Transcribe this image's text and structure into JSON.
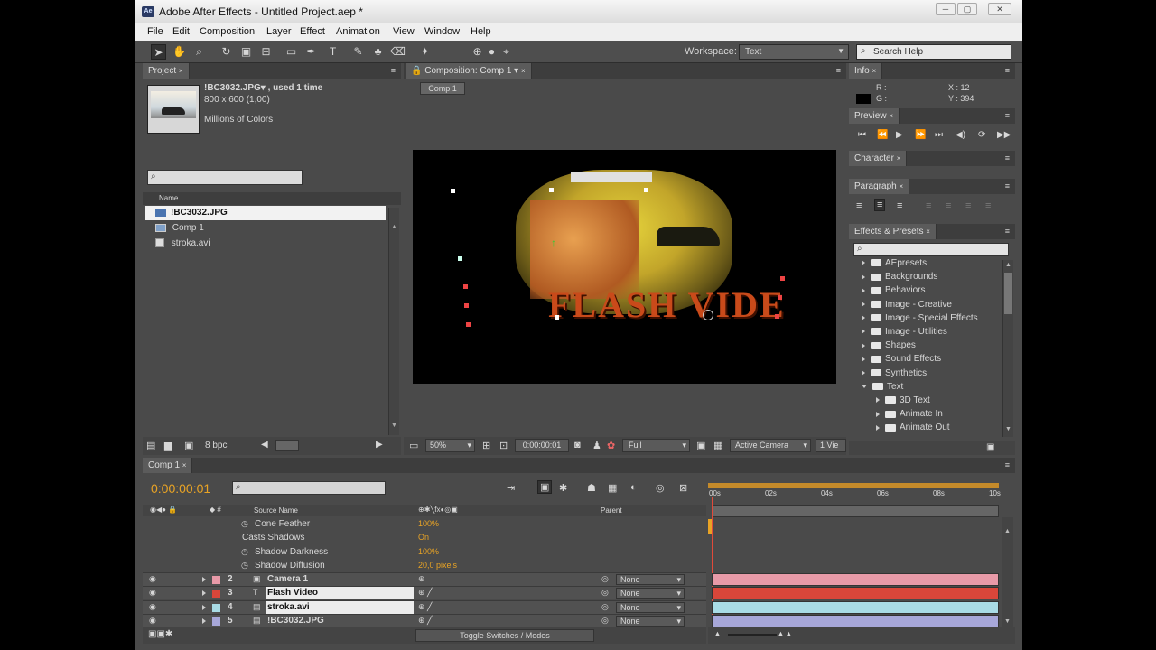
{
  "window": {
    "title": "Adobe After Effects - Untitled Project.aep *",
    "app_badge": "Ae",
    "min": "─",
    "max": "▢",
    "close": "✕"
  },
  "menu": [
    "File",
    "Edit",
    "Composition",
    "Layer",
    "Effect",
    "Animation",
    "View",
    "Window",
    "Help"
  ],
  "toolbar": {
    "workspace_label": "Workspace:",
    "workspace_value": "Text",
    "search_placeholder": "Search Help"
  },
  "project": {
    "tab": "Project",
    "file_name": "!BC3032.JPG▾ , used 1 time",
    "file_dims": "800 x 600 (1,00)",
    "file_colors": "Millions of Colors",
    "col_name": "Name",
    "items": [
      "!BC3032.JPG",
      "Comp 1",
      "stroka.avi"
    ],
    "bpc": "8 bpc"
  },
  "composition": {
    "tab": "Composition: Comp 1",
    "crumb": "Comp 1",
    "zoom": "50%",
    "timecode": "0:00:00:01",
    "resolution": "Full",
    "camera": "Active Camera",
    "views": "1 Vie",
    "overlay_text": "FLASH VIDE"
  },
  "info": {
    "tab": "Info",
    "r": "R :",
    "g": "G :",
    "x": "X : 12",
    "y": "Y : 394"
  },
  "preview": {
    "tab": "Preview"
  },
  "character": {
    "tab": "Character"
  },
  "paragraph": {
    "tab": "Paragraph"
  },
  "effects": {
    "tab": "Effects & Presets",
    "items": [
      {
        "label": "AEpresets",
        "level": 1,
        "open": false
      },
      {
        "label": "Backgrounds",
        "level": 1,
        "open": false
      },
      {
        "label": "Behaviors",
        "level": 1,
        "open": false
      },
      {
        "label": "Image - Creative",
        "level": 1,
        "open": false
      },
      {
        "label": "Image - Special Effects",
        "level": 1,
        "open": false
      },
      {
        "label": "Image - Utilities",
        "level": 1,
        "open": false
      },
      {
        "label": "Shapes",
        "level": 1,
        "open": false
      },
      {
        "label": "Sound Effects",
        "level": 1,
        "open": false
      },
      {
        "label": "Synthetics",
        "level": 1,
        "open": false
      },
      {
        "label": "Text",
        "level": 1,
        "open": true
      },
      {
        "label": "3D Text",
        "level": 2,
        "open": false
      },
      {
        "label": "Animate In",
        "level": 2,
        "open": false
      },
      {
        "label": "Animate Out",
        "level": 2,
        "open": false
      }
    ]
  },
  "timeline": {
    "tab": "Comp 1",
    "timecode": "0:00:00:01",
    "col_source": "Source Name",
    "col_parent": "Parent",
    "ruler": [
      "00s",
      "02s",
      "04s",
      "06s",
      "08s",
      "10s"
    ],
    "props": [
      {
        "name": "Cone Feather",
        "value": "100%"
      },
      {
        "name": "Casts Shadows",
        "value": "On"
      },
      {
        "name": "Shadow Darkness",
        "value": "100%"
      },
      {
        "name": "Shadow Diffusion",
        "value": "20,0 pixels"
      }
    ],
    "layers": [
      {
        "num": "2",
        "name": "Camera 1",
        "parent": "None",
        "color": "#e89aa8"
      },
      {
        "num": "3",
        "name": "Flash Video",
        "parent": "None",
        "color": "#d9463a"
      },
      {
        "num": "4",
        "name": "stroka.avi",
        "parent": "None",
        "color": "#a9dce6"
      },
      {
        "num": "5",
        "name": "!BC3032.JPG",
        "parent": "None",
        "color": "#a7a7d9"
      }
    ],
    "toggle_label": "Toggle Switches / Modes"
  },
  "colors": {
    "accent": "#e8a325",
    "panel": "#4a4a4a",
    "dark": "#353535"
  }
}
